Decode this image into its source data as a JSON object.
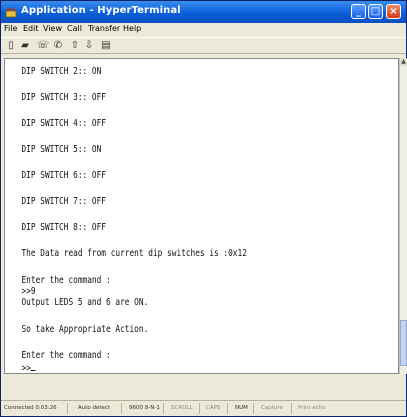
{
  "window": {
    "title": "Application - HyperTerminal",
    "colors": {
      "titlebar": "#0a5fd8",
      "terminal_bg": "#ffffff",
      "terminal_text": "#111111"
    }
  },
  "menu": [
    "File",
    "Edit",
    "View",
    "Call",
    "Transfer",
    "Help"
  ],
  "toolbar": {
    "icons": [
      "new-icon",
      "open-icon",
      "phone-icon",
      "hangup-icon",
      "send-icon",
      "receive-icon",
      "properties-icon"
    ]
  },
  "terminal": {
    "lines": [
      "DIP SWITCH 2:: ON",
      "DIP SWITCH 3:: OFF",
      "DIP SWITCH 4:: OFF",
      "DIP SWITCH 5:: ON",
      "DIP SWITCH 6:: OFF",
      "DIP SWITCH 7:: OFF",
      "DIP SWITCH 8:: OFF",
      "The Data read from current dip switches is :0x12",
      "Enter the command :",
      ">>9",
      "Output LEDS 5 and 6 are ON.",
      "So take Appropriate Action.",
      "Enter the command :",
      ">>"
    ]
  },
  "status": {
    "connected": "Connected 0:03:26",
    "detect": "Auto detect",
    "baud": "9600 8-N-1",
    "scroll": "SCROLL",
    "caps": "CAPS",
    "num": "NUM",
    "capture": "Capture",
    "print_echo": "Print echo"
  }
}
